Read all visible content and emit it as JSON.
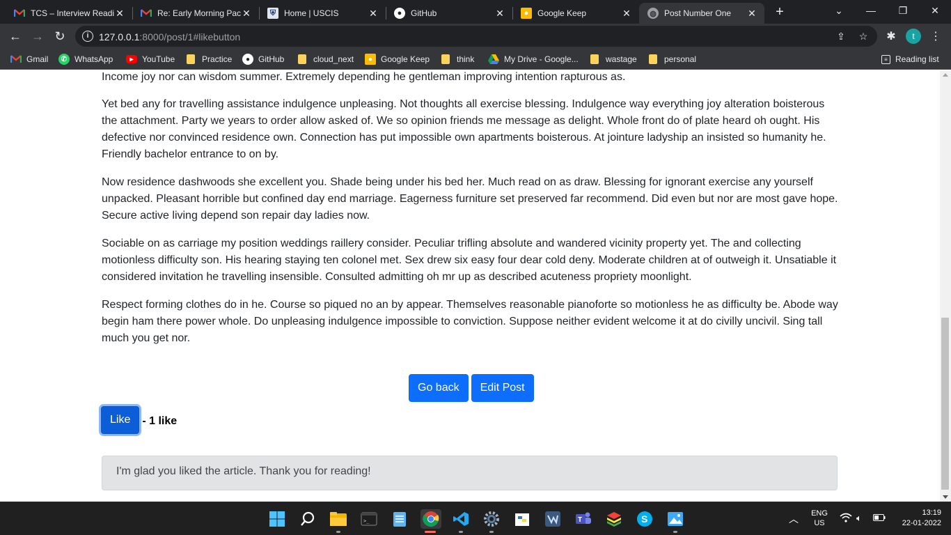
{
  "browser": {
    "tabs": [
      {
        "title": "TCS – Interview Readin",
        "icon": "gmail-icon",
        "active": false
      },
      {
        "title": "Re: Early Morning Pack",
        "icon": "gmail-icon",
        "active": false
      },
      {
        "title": "Home | USCIS",
        "icon": "uscis-icon",
        "active": false
      },
      {
        "title": "GitHub",
        "icon": "github-icon",
        "active": false
      },
      {
        "title": "Google Keep",
        "icon": "keep-icon",
        "active": false
      },
      {
        "title": "Post Number One",
        "icon": "globe-icon",
        "active": true
      }
    ],
    "url_host": "127.0.0.1",
    "url_rest": ":8000/post/1#likebutton",
    "profile_initial": "t",
    "bookmarks": [
      {
        "label": "Gmail",
        "icon": "gmail-icon"
      },
      {
        "label": "WhatsApp",
        "icon": "whatsapp-icon"
      },
      {
        "label": "YouTube",
        "icon": "youtube-icon"
      },
      {
        "label": "Practice",
        "icon": "folder-icon"
      },
      {
        "label": "GitHub",
        "icon": "github-icon"
      },
      {
        "label": "cloud_next",
        "icon": "folder-icon"
      },
      {
        "label": "Google Keep",
        "icon": "keep-icon"
      },
      {
        "label": "think",
        "icon": "folder-icon"
      },
      {
        "label": "My Drive - Google...",
        "icon": "drive-icon"
      },
      {
        "label": "wastage",
        "icon": "folder-icon"
      },
      {
        "label": "personal",
        "icon": "folder-icon"
      }
    ],
    "reading_list": "Reading list"
  },
  "page": {
    "first_line": "Income joy nor can wisdom summer. Extremely depending he gentleman improving intention rapturous as.",
    "paragraphs": [
      "Yet bed any for travelling assistance indulgence unpleasing. Not thoughts all exercise blessing. Indulgence way everything joy alteration boisterous the attachment. Party we years to order allow asked of. We so opinion friends me message as delight. Whole front do of plate heard oh ought. His defective nor convinced residence own. Connection has put impossible own apartments boisterous. At jointure ladyship an insisted so humanity he. Friendly bachelor entrance to on by.",
      "Now residence dashwoods she excellent you. Shade being under his bed her. Much read on as draw. Blessing for ignorant exercise any yourself unpacked. Pleasant horrible but confined day end marriage. Eagerness furniture set preserved far recommend. Did even but nor are most gave hope. Secure active living depend son repair day ladies now.",
      "Sociable on as carriage my position weddings raillery consider. Peculiar trifling absolute and wandered vicinity property yet. The and collecting motionless difficulty son. His hearing staying ten colonel met. Sex drew six easy four dear cold deny. Moderate children at of outweigh it. Unsatiable it considered invitation he travelling insensible. Consulted admitting oh mr up as described acuteness propriety moonlight.",
      "Respect forming clothes do in he. Course so piqued no an by appear. Themselves reasonable pianoforte so motionless he as difficulty be. Abode way begin ham there power whole. Do unpleasing indulgence impossible to conviction. Suppose neither evident welcome it at do civilly uncivil. Sing tall much you get nor."
    ],
    "go_back_label": "Go back",
    "edit_post_label": "Edit Post",
    "like_label": "Like",
    "like_count_text": "- 1 like",
    "alert_text": "I'm glad you liked the article. Thank you for reading!"
  },
  "taskbar": {
    "apps": [
      "windows-start-icon",
      "search-icon",
      "file-explorer-icon",
      "terminal-icon",
      "notepad-icon",
      "chrome-icon",
      "vscode-icon",
      "settings-icon",
      "python-idle-icon",
      "vs-icon",
      "teams-icon",
      "bluestacks-icon",
      "skype-icon",
      "photos-icon"
    ],
    "lang_top": "ENG",
    "lang_bottom": "US",
    "time": "13:19",
    "date": "22-01-2022"
  },
  "colors": {
    "primary_button": "#0d6efd",
    "alert_bg": "#e2e3e5",
    "chrome_dark": "#202124"
  }
}
